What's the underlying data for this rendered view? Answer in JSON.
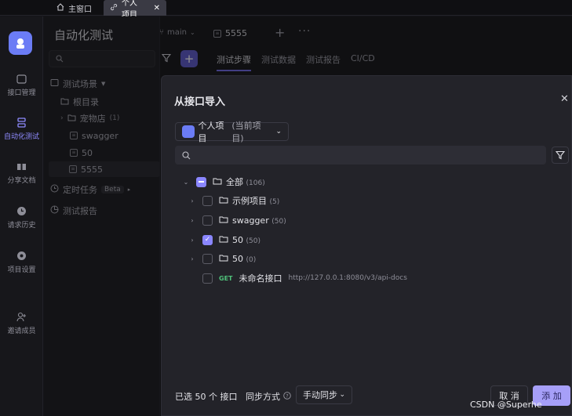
{
  "window_tabs": [
    {
      "label": "主窗口",
      "icon": "home-icon"
    },
    {
      "label": "个人项目",
      "icon": "link-icon"
    }
  ],
  "rail": {
    "items": [
      {
        "label": "接口管理",
        "icon": "api-icon"
      },
      {
        "label": "自动化测试",
        "icon": "test-icon"
      },
      {
        "label": "分享文档",
        "icon": "book-icon"
      },
      {
        "label": "请求历史",
        "icon": "history-icon"
      },
      {
        "label": "项目设置",
        "icon": "settings-icon"
      },
      {
        "label": "邀请成员",
        "icon": "invite-icon"
      }
    ]
  },
  "panel": {
    "title": "自动化测试",
    "tree": [
      {
        "label": "测试场景",
        "icon": "scenario-icon"
      },
      {
        "label": "根目录",
        "icon": "folder-icon"
      },
      {
        "label": "宠物店",
        "count": "(1)",
        "icon": "folder-icon"
      },
      {
        "label": "swagger",
        "icon": "file-icon"
      },
      {
        "label": "50",
        "icon": "file-icon"
      },
      {
        "label": "5555",
        "icon": "file-icon"
      },
      {
        "label": "定时任务",
        "badge": "Beta",
        "icon": "clock-icon"
      },
      {
        "label": "测试报告",
        "icon": "report-icon"
      }
    ]
  },
  "workspace": {
    "branch": "main",
    "doc_tab": "5555",
    "subtabs": [
      "测试步骤",
      "测试数据",
      "测试报告",
      "CI/CD"
    ]
  },
  "modal": {
    "title": "从接口导入",
    "project": {
      "name": "个人项目",
      "suffix": "(当前项目)"
    },
    "search_placeholder": "",
    "tree": [
      {
        "label": "全部",
        "count": "(106)",
        "state": "partial"
      },
      {
        "label": "示例项目",
        "count": "(5)",
        "state": "unchecked"
      },
      {
        "label": "swagger",
        "count": "(50)",
        "state": "unchecked"
      },
      {
        "label": "50",
        "count": "(50)",
        "state": "checked"
      },
      {
        "label": "50",
        "count": "(0)",
        "state": "unchecked"
      },
      {
        "label": "未命名接口",
        "method": "GET",
        "url": "http://127.0.0.1:8080/v3/api-docs",
        "state": "unchecked"
      }
    ],
    "footer": {
      "selected": "已选 50 个 接口",
      "sync_label": "同步方式",
      "sync_value": "手动同步",
      "cancel": "取 消",
      "add": "添 加"
    }
  },
  "watermark": "CSDN @Superhe"
}
